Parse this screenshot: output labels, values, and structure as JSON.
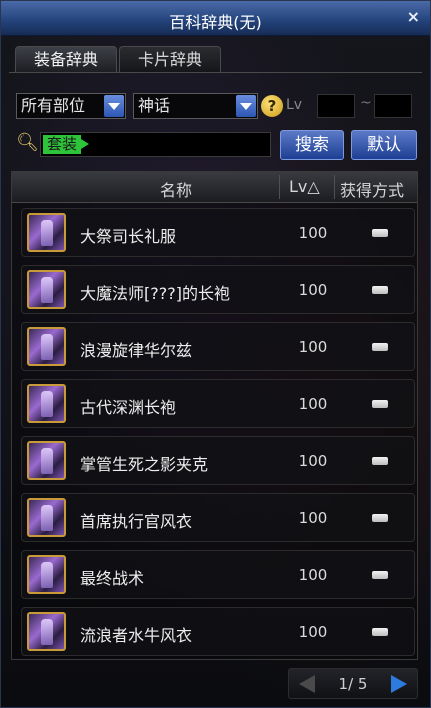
{
  "window": {
    "title": "百科辞典(无)",
    "close_label": "×"
  },
  "tabs": [
    {
      "label": "装备辞典"
    },
    {
      "label": "卡片辞典"
    }
  ],
  "filters": {
    "part": "所有部位",
    "rarity": "神话",
    "help_label": "?",
    "lv_label": "Lv",
    "lv_min": "",
    "lv_max": "",
    "lv_sep": "~"
  },
  "search": {
    "icon": "search-icon",
    "value": "套装",
    "search_button": "搜索",
    "default_button": "默认"
  },
  "table": {
    "headers": {
      "name": "名称",
      "lv": "Lv△",
      "source": "获得方式"
    },
    "rows": [
      {
        "icon": "robe-icon",
        "name": "大祭司长礼服",
        "lv": "100"
      },
      {
        "icon": "robe-icon",
        "name": "大魔法师[???]的长袍",
        "lv": "100"
      },
      {
        "icon": "robe-icon",
        "name": "浪漫旋律华尔兹",
        "lv": "100"
      },
      {
        "icon": "robe-icon",
        "name": "古代深渊长袍",
        "lv": "100"
      },
      {
        "icon": "robe-icon",
        "name": "掌管生死之影夹克",
        "lv": "100"
      },
      {
        "icon": "robe-icon",
        "name": "首席执行官风衣",
        "lv": "100"
      },
      {
        "icon": "robe-icon",
        "name": "最终战术",
        "lv": "100"
      },
      {
        "icon": "robe-icon",
        "name": "流浪者水牛风衣",
        "lv": "100"
      }
    ]
  },
  "pagination": {
    "label": "1/ 5",
    "current": 1,
    "total": 5
  },
  "colors": {
    "title_bar": "#2a4a88",
    "button_blue": "#2d56b4",
    "highlight_green": "#2ec43a",
    "icon_border": "#c89a3a",
    "next_arrow": "#2e7be0"
  }
}
